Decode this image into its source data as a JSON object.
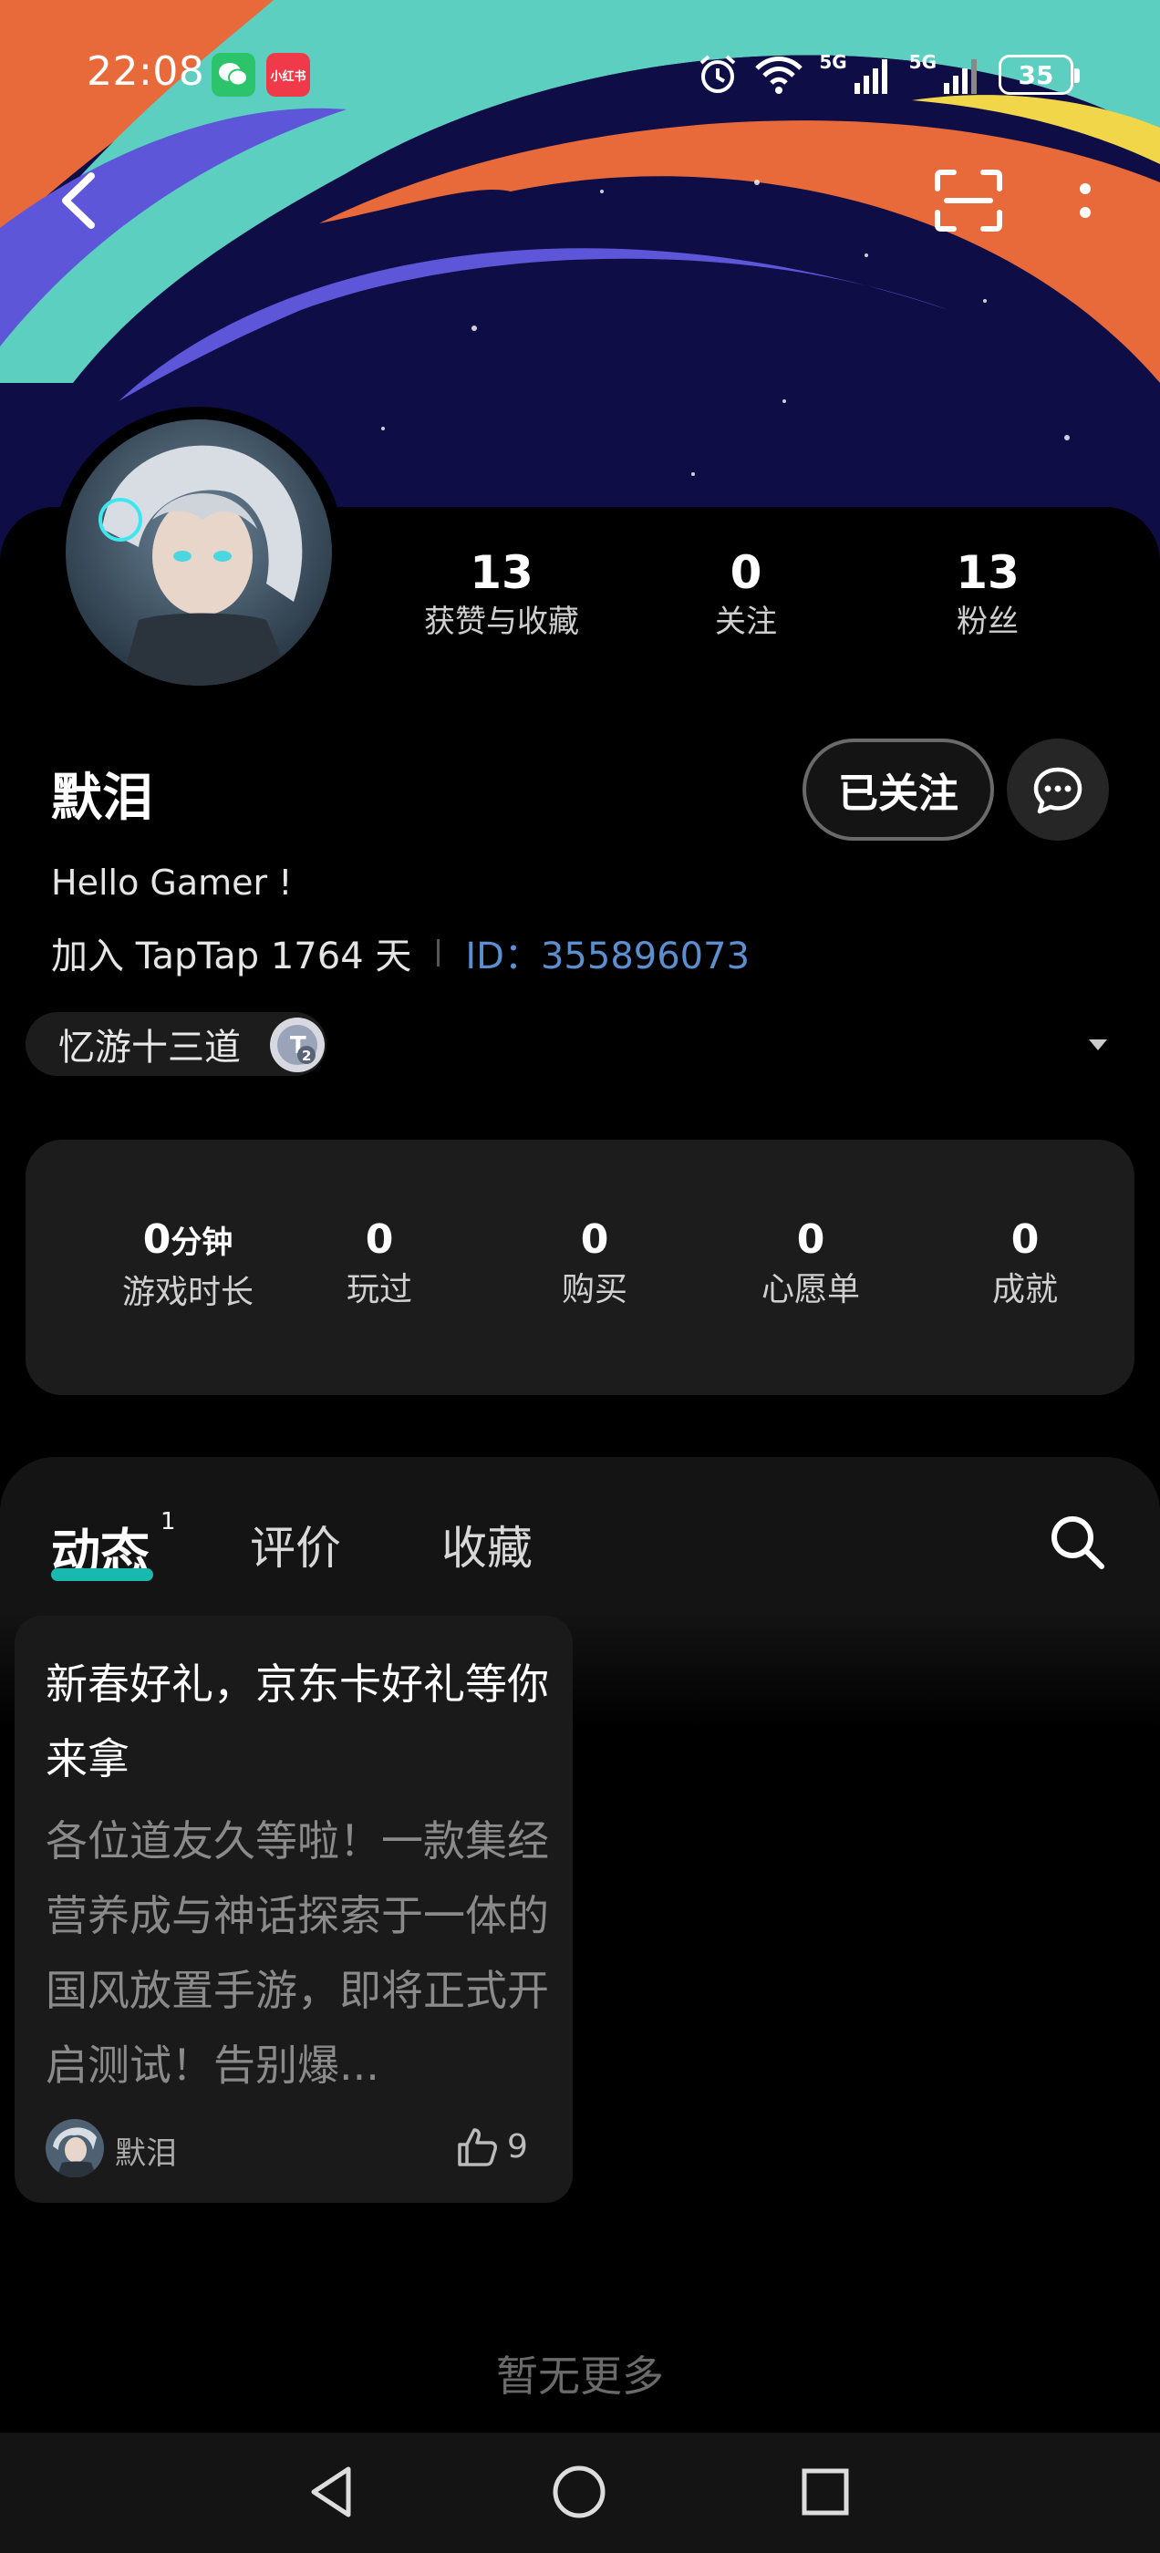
{
  "status_bar": {
    "time": "22:08",
    "apps": [
      "wechat-icon",
      "xiaohongshu-icon"
    ],
    "xhs_label": "小红书",
    "signal_1": "5G",
    "signal_2": "5G",
    "battery": "35"
  },
  "profile": {
    "stats": [
      {
        "value": "13",
        "label": "获赞与收藏"
      },
      {
        "value": "0",
        "label": "关注"
      },
      {
        "value": "13",
        "label": "粉丝"
      }
    ],
    "name": "默泪",
    "follow_label": "已关注",
    "bio": "Hello Gamer !",
    "joined": "加入 TapTap 1764 天",
    "id_text": "ID：355896073",
    "guild": "忆游十三道"
  },
  "game_stats": [
    {
      "value": "0",
      "unit": "分钟",
      "label": "游戏时长"
    },
    {
      "value": "0",
      "label": "玩过"
    },
    {
      "value": "0",
      "label": "购买"
    },
    {
      "value": "0",
      "label": "心愿单"
    },
    {
      "value": "0",
      "label": "成就"
    }
  ],
  "tabs": {
    "items": [
      "动态",
      "评价",
      "收藏"
    ],
    "active_badge": "1"
  },
  "post": {
    "title": "新春好礼，京东卡好礼等你来拿",
    "body": "各位道友久等啦！一款集经营养成与神话探索于一体的国风放置手游，即将正式开启测试！告别爆...",
    "author": "默泪",
    "likes": "9"
  },
  "footer": {
    "no_more": "暂无更多"
  },
  "colors": {
    "accent": "#19b9b0",
    "id_link": "#5b8fcf"
  }
}
